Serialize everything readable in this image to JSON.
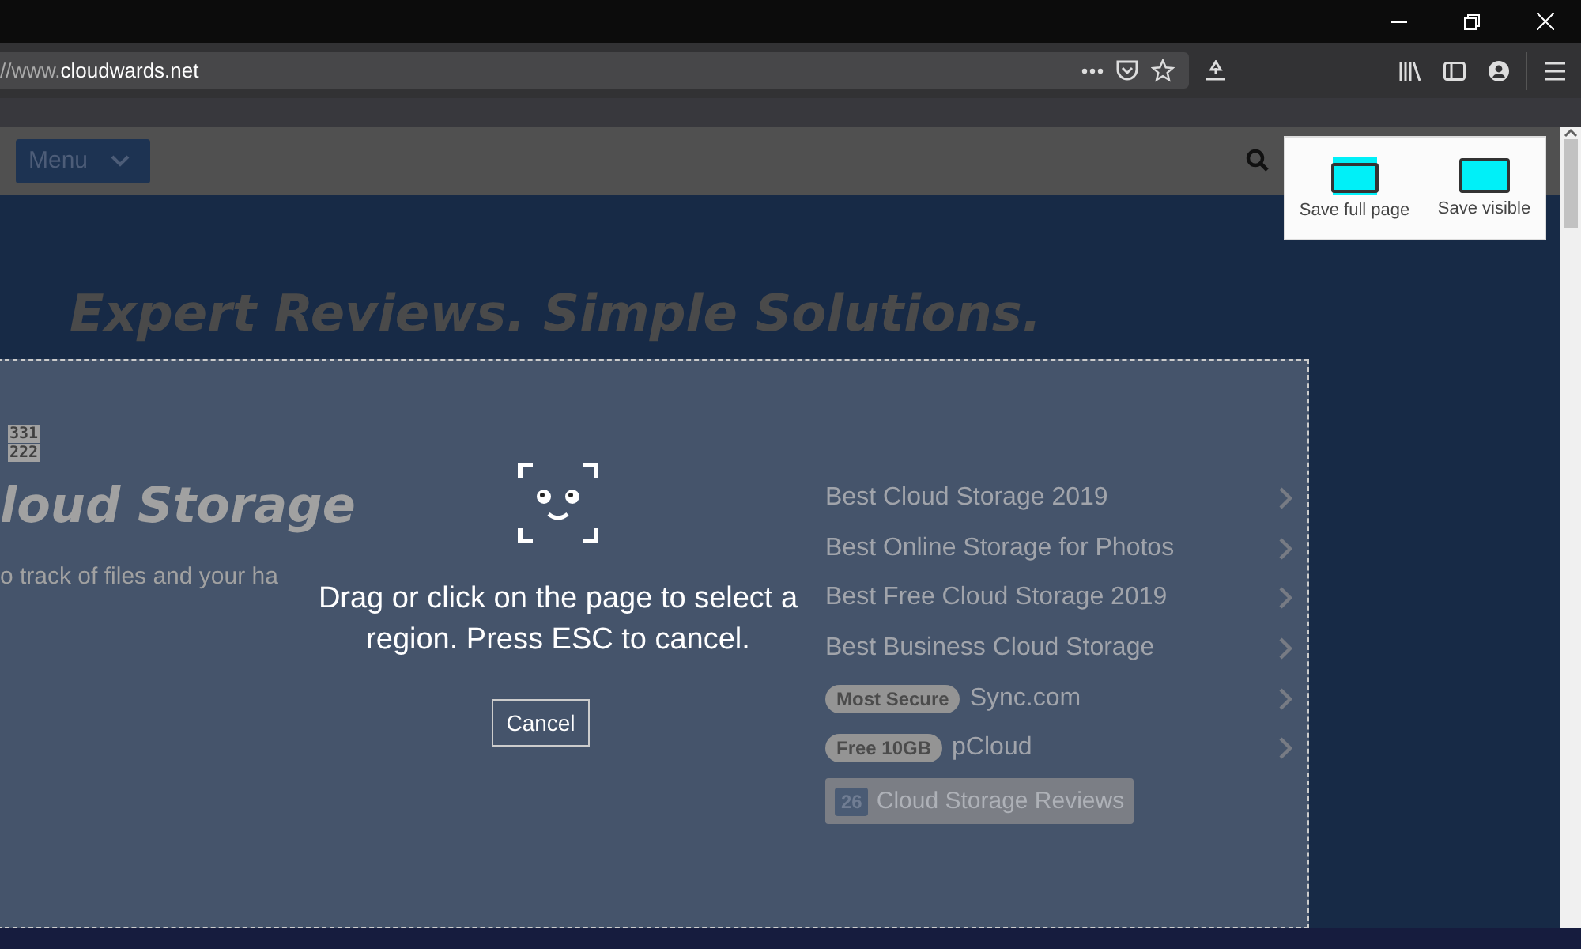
{
  "address_bar": {
    "prefix": "//www.",
    "domain": "cloudwards.net"
  },
  "site": {
    "menu_button": "Menu",
    "headline": "Expert Reviews. Simple Solutions.",
    "counters": [
      "331",
      "222"
    ],
    "hero_title": "loud Storage",
    "hero_text": "o track of files and your ha",
    "links": [
      {
        "kind": "link",
        "label": "Best Cloud Storage 2019"
      },
      {
        "kind": "link",
        "label": "Best Online Storage for Photos"
      },
      {
        "kind": "link",
        "label": "Best Free Cloud Storage 2019"
      },
      {
        "kind": "link",
        "label": "Best Business Cloud Storage"
      },
      {
        "kind": "tagged",
        "tag": "Most Secure",
        "label": "Sync.com"
      },
      {
        "kind": "tagged",
        "tag": "Free 10GB",
        "label": "pCloud"
      }
    ],
    "reviews_button": {
      "count": "26",
      "label": "Cloud Storage Reviews"
    }
  },
  "capture": {
    "message": "Drag or click on the page to select a region. Press ESC to cancel.",
    "cancel": "Cancel",
    "save_options": [
      "Save full page",
      "Save visible"
    ]
  }
}
